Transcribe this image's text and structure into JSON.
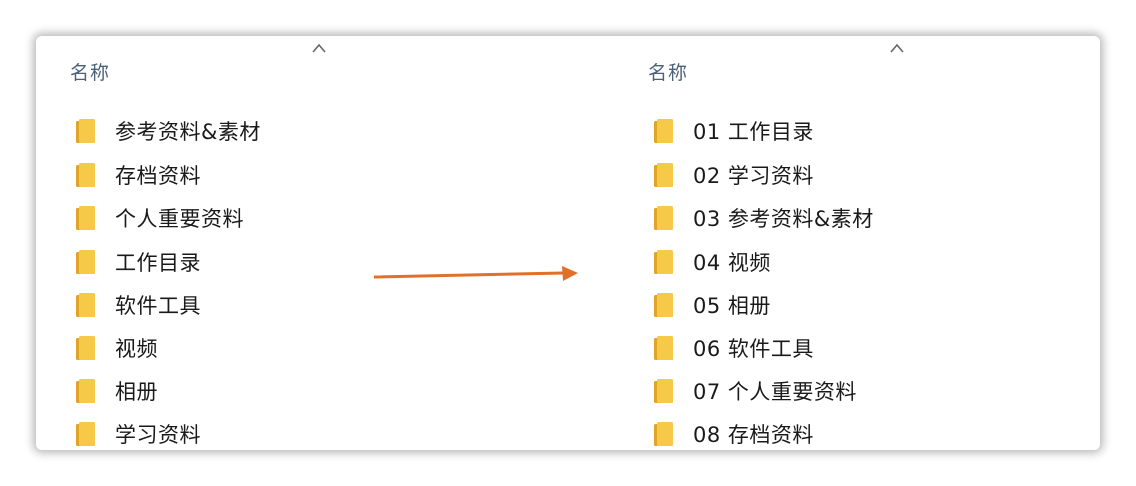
{
  "left_pane": {
    "header": "名称",
    "items": [
      {
        "label": "参考资料&素材"
      },
      {
        "label": "存档资料"
      },
      {
        "label": "个人重要资料"
      },
      {
        "label": "工作目录"
      },
      {
        "label": "软件工具"
      },
      {
        "label": "视频"
      },
      {
        "label": "相册"
      },
      {
        "label": "学习资料"
      }
    ]
  },
  "right_pane": {
    "header": "名称",
    "items": [
      {
        "label": "01 工作目录"
      },
      {
        "label": "02 学习资料"
      },
      {
        "label": "03 参考资料&素材"
      },
      {
        "label": "04 视频"
      },
      {
        "label": "05 相册"
      },
      {
        "label": "06 软件工具"
      },
      {
        "label": "07 个人重要资料"
      },
      {
        "label": "08 存档资料"
      }
    ]
  },
  "icons": {
    "folder": "folder-icon",
    "sort": "chevron-up-icon",
    "arrow": "right-arrow-icon"
  },
  "colors": {
    "folder_body": "#f7c948",
    "folder_dark": "#e0a526",
    "arrow": "#e0702a",
    "header_text": "#4c6077"
  }
}
